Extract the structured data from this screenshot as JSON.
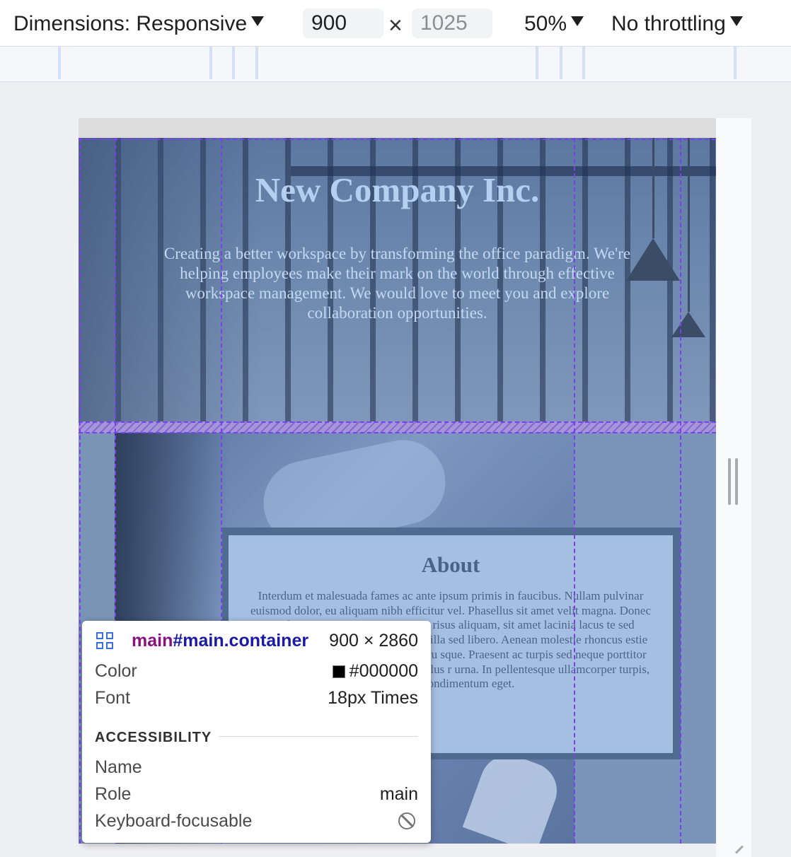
{
  "toolbar": {
    "dimensions_label": "Dimensions: Responsive",
    "width_value": "900",
    "times_symbol": "×",
    "height_placeholder": "1025",
    "zoom": "50%",
    "throttling": "No throttling"
  },
  "page": {
    "hero_title": "New Company Inc.",
    "hero_text": "Creating a better workspace by transforming the office paradigm. We're helping employees make their mark on the world through effective workspace management. We would love to meet you and explore collaboration opportunities.",
    "about_title": "About",
    "about_text": "Interdum et malesuada fames ac ante ipsum primis in faucibus. Nullam pulvinar euismod dolor, eu aliquam nibh efficitur vel. Phasellus sit amet velit magna. Donec eu ultrices eros. Donec sit sto non risus aliquam, sit amet lacinia lacus te sed semper porta. Integer eros tortor, ingilla sed libero. Aenean molestie rhoncus estie massa. Maecenas auctor sapien a arcu sque. Praesent ac turpis sed neque porttitor bi tempus turpis lacus, nec laoreet tellus r urna. In pellentesque ullamcorper turpis, mauris condimentum eget."
  },
  "tooltip": {
    "tag": "main",
    "id_class": "#main.container",
    "size": "900 × 2860",
    "color_label": "Color",
    "color_value": "#000000",
    "font_label": "Font",
    "font_value": "18px Times",
    "section_title": "ACCESSIBILITY",
    "name_label": "Name",
    "name_value": "",
    "role_label": "Role",
    "role_value": "main",
    "focusable_label": "Keyboard-focusable"
  },
  "colors": {
    "grid_overlay": "#7b3ff2",
    "tag_color": "#881280",
    "selector_color": "#1a1aa6",
    "swatch": "#000000"
  },
  "icons": [
    "dropdown-arrow-icon",
    "times-icon",
    "grid-icon",
    "not-allowed-icon",
    "resize-handle-icon"
  ]
}
